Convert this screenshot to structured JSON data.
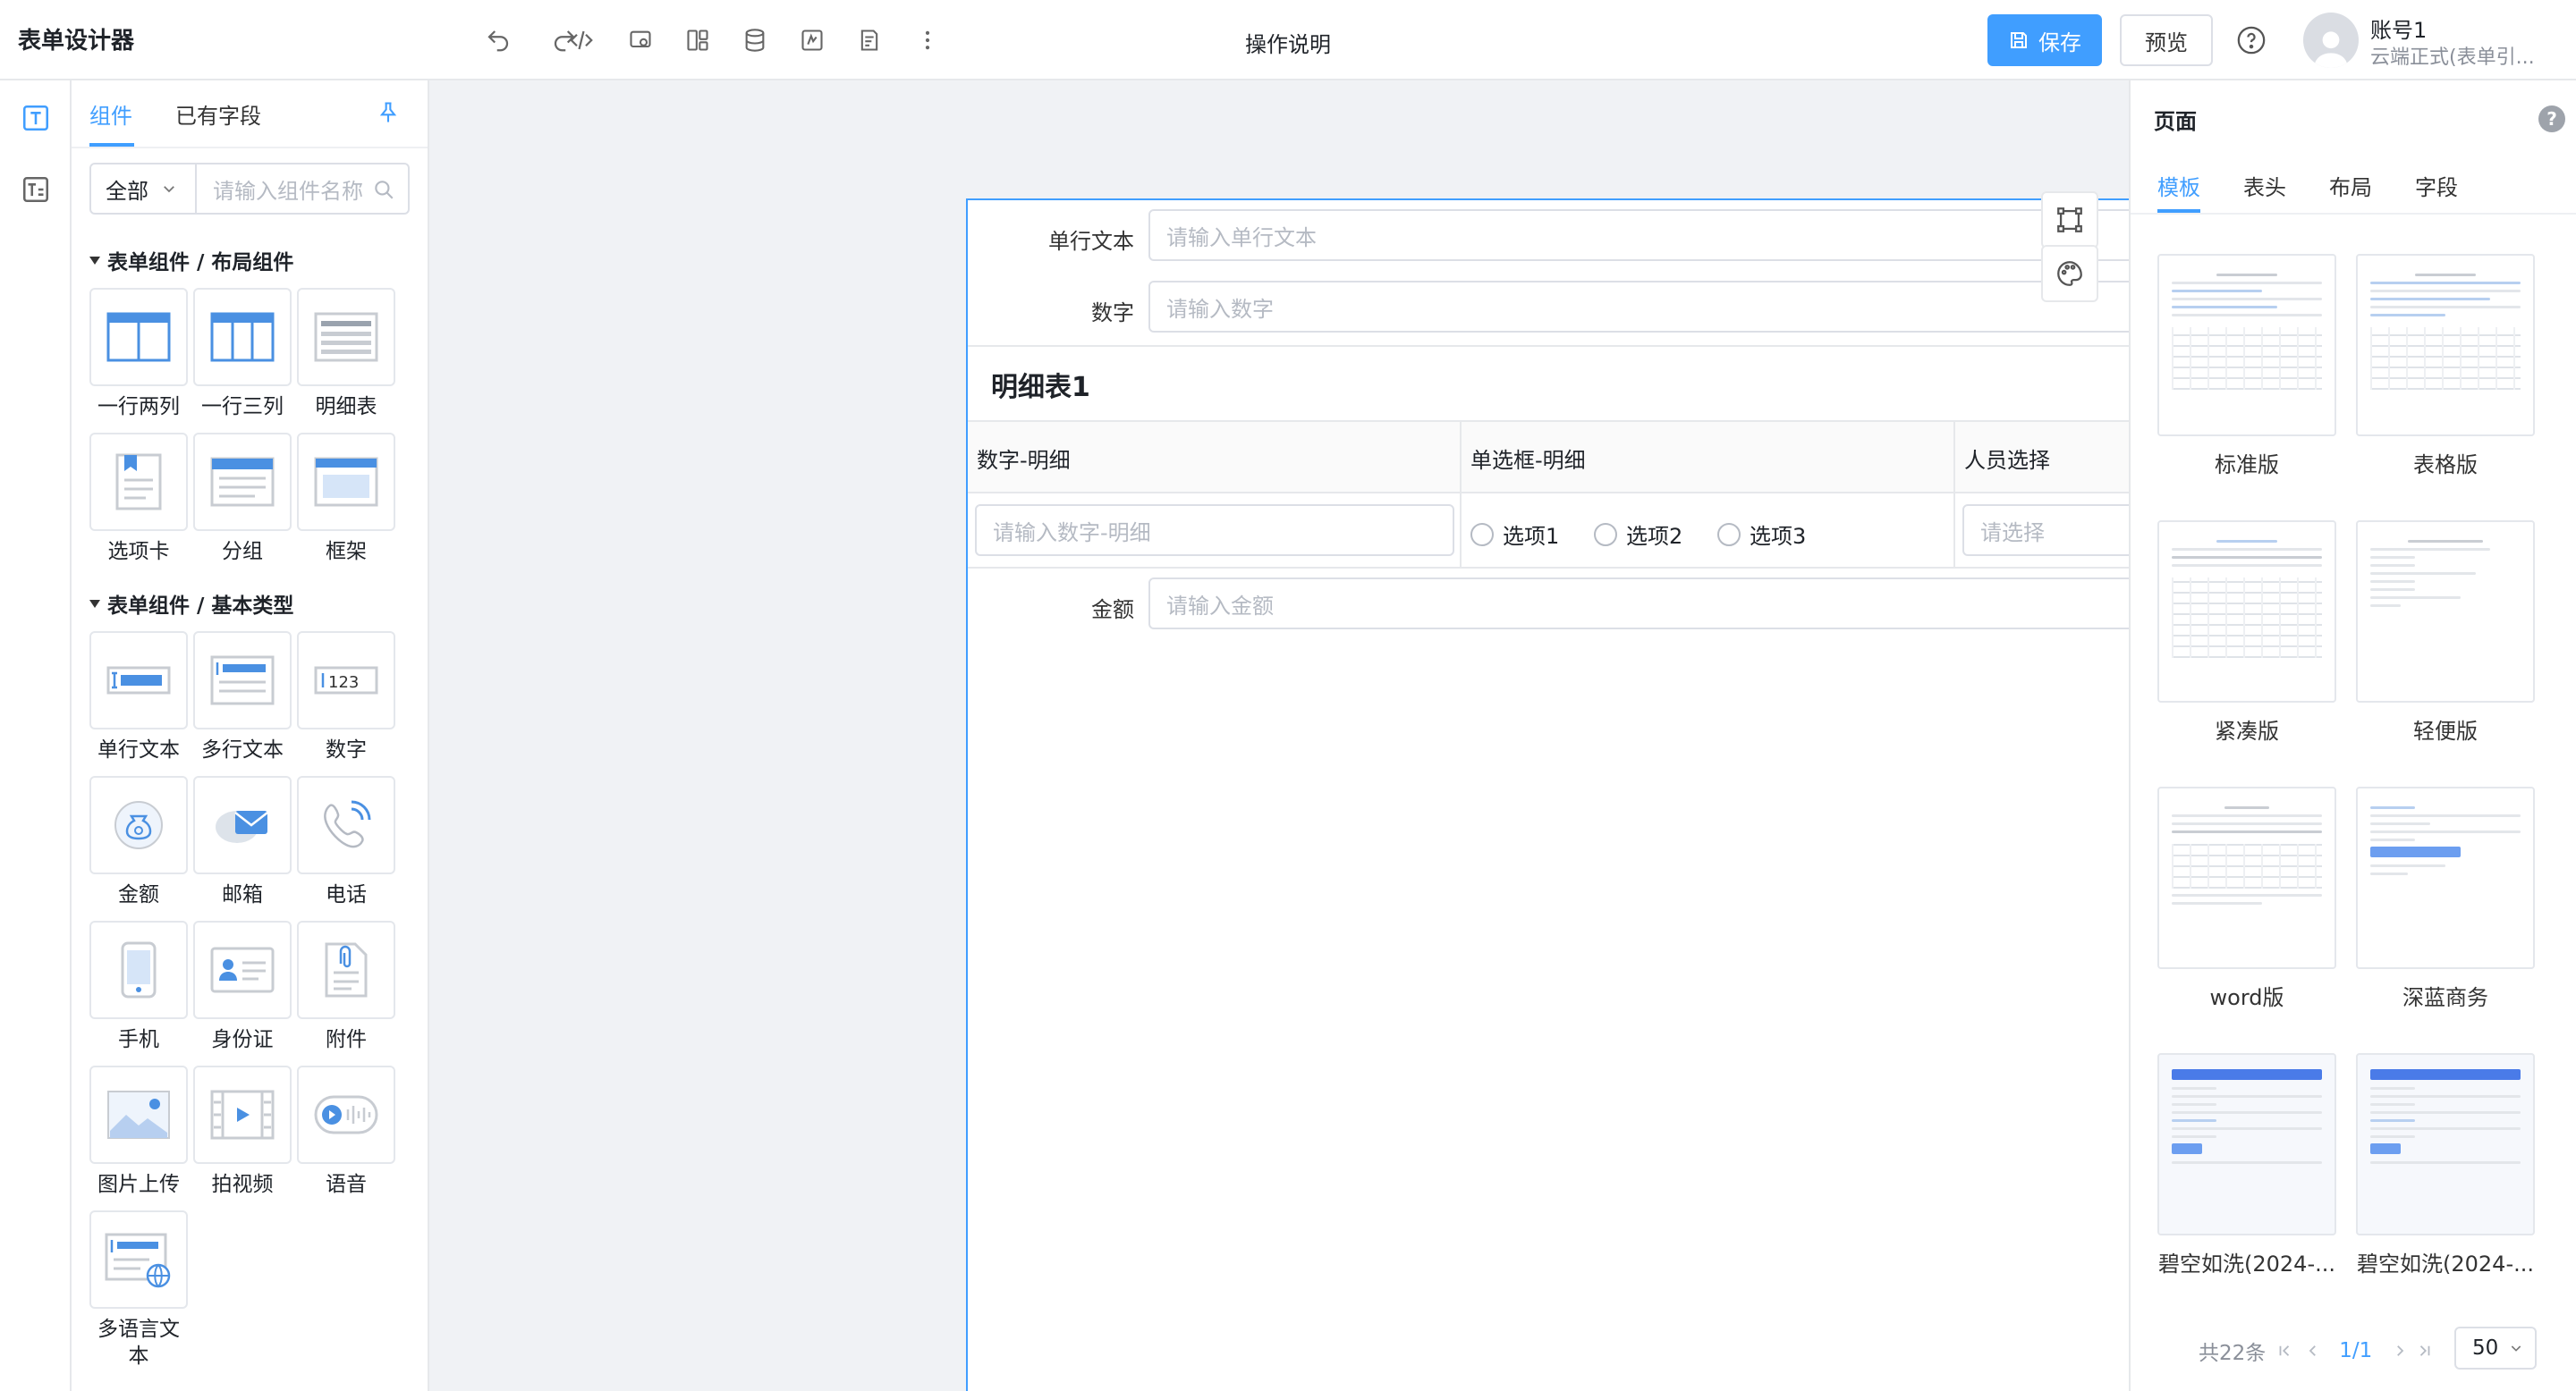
{
  "app": {
    "title": "表单设计器",
    "center_title": "操作说明"
  },
  "toolbar": {
    "icons": [
      "undo-icon",
      "redo-icon",
      "code-icon",
      "form-settings-icon",
      "layout-icon",
      "data-source-icon",
      "formula-icon",
      "rules-icon",
      "more-icon"
    ],
    "save_label": "保存",
    "preview_label": "预览"
  },
  "account": {
    "name": "账号1",
    "sub": "云端正式(表单引..."
  },
  "left_panel": {
    "tabs": [
      "组件",
      "已有字段"
    ],
    "filter_value": "全部",
    "search_placeholder": "请输入组件名称",
    "groups": [
      {
        "title": "表单组件 / 布局组件",
        "items": [
          "一行两列",
          "一行三列",
          "明细表",
          "选项卡",
          "分组",
          "框架"
        ]
      },
      {
        "title": "表单组件 / 基本类型",
        "items": [
          "单行文本",
          "多行文本",
          "数字",
          "金额",
          "邮箱",
          "电话",
          "手机",
          "身份证",
          "附件",
          "图片上传",
          "拍视频",
          "语音",
          "多语言文本"
        ]
      }
    ]
  },
  "form": {
    "fields": [
      {
        "label": "单行文本",
        "placeholder": "请输入单行文本"
      },
      {
        "label": "数字",
        "placeholder": "请输入数字"
      }
    ],
    "detail": {
      "title": "明细表1",
      "columns": [
        "数字-明细",
        "单选框-明细",
        "人员选择"
      ],
      "number_placeholder": "请输入数字-明细",
      "options": [
        "选项1",
        "选项2",
        "选项3"
      ],
      "person_placeholder": "请选择"
    },
    "amount": {
      "label": "金额",
      "placeholder": "请输入金额"
    }
  },
  "right_panel": {
    "title": "页面",
    "help": "?",
    "tabs": [
      "模板",
      "表头",
      "布局",
      "字段"
    ],
    "templates": [
      "标准版",
      "表格版",
      "紧凑版",
      "轻便版",
      "word版",
      "深蓝商务",
      "碧空如洗(2024-...",
      "碧空如洗(2024-..."
    ],
    "pagination": {
      "total": "共22条",
      "current": "1",
      "pages": "/1",
      "page_size": "50"
    }
  },
  "colors": {
    "primary": "#409eff",
    "annotation_arrow": "#ff1a1a"
  }
}
